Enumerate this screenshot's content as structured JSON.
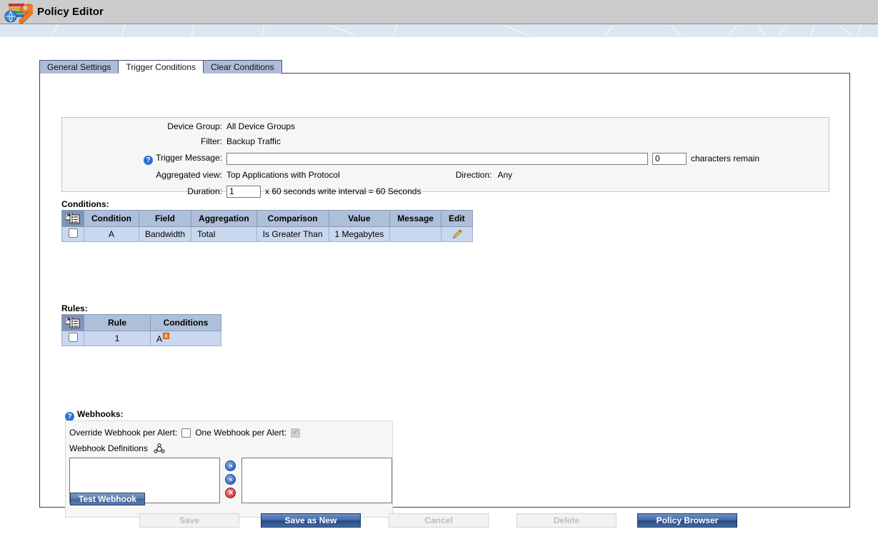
{
  "app": {
    "title": "Policy Editor",
    "logo_icon": "bar-chart-globe-wrench-icon"
  },
  "tabs": [
    {
      "label": "General Settings",
      "active": false
    },
    {
      "label": "Trigger Conditions",
      "active": true
    },
    {
      "label": "Clear Conditions",
      "active": false
    }
  ],
  "info": {
    "device_group_label": "Device Group:",
    "device_group_value": "All Device Groups",
    "filter_label": "Filter:",
    "filter_value": "Backup Traffic",
    "trigger_message_label": "Trigger Message:",
    "trigger_message_value": "",
    "trigger_message_help_icon": "help-icon",
    "chars_remain_value": "0",
    "chars_remain_label": "characters remain",
    "aggregated_view_label": "Aggregated view:",
    "aggregated_view_value": "Top Applications with Protocol",
    "direction_label": "Direction:",
    "direction_value": "Any",
    "duration_label": "Duration:",
    "duration_value": "1",
    "duration_note": "x 60 seconds write interval = 60 Seconds"
  },
  "conditions": {
    "section_label": "Conditions:",
    "select_icon": "select-list-icon",
    "columns": [
      "Condition",
      "Field",
      "Aggregation",
      "Comparison",
      "Value",
      "Message",
      "Edit"
    ],
    "rows": [
      {
        "checked": false,
        "condition": "A",
        "field": "Bandwidth",
        "aggregation": "Total",
        "comparison": "Is Greater Than",
        "value": "1 Megabytes",
        "message": "",
        "edit_icon": "pencil-icon"
      }
    ]
  },
  "rules": {
    "section_label": "Rules:",
    "select_icon": "select-list-icon",
    "columns": [
      "Rule",
      "Conditions"
    ],
    "rows": [
      {
        "checked": false,
        "rule": "1",
        "conditions": "A",
        "remove_badge": "x"
      }
    ]
  },
  "webhooks": {
    "section_label": "Webhooks:",
    "help_icon": "help-icon",
    "override_label": "Override Webhook per Alert:",
    "override_checked": false,
    "one_per_alert_label": "One Webhook per Alert:",
    "one_per_alert_checked": true,
    "one_per_alert_disabled": true,
    "definitions_label": "Webhook Definitions",
    "definitions_icon": "gear-cog-icon",
    "available_items": [],
    "selected_items": [],
    "move_right_icon": "double-chevron-right-icon",
    "move_left_icon": "double-chevron-left-icon",
    "delete_icon": "delete-x-icon",
    "test_button_label": "Test Webhook"
  },
  "footer": {
    "buttons": [
      {
        "label": "Save",
        "enabled": false
      },
      {
        "label": "Save as New",
        "enabled": true
      },
      {
        "label": "Cancel",
        "enabled": false
      },
      {
        "label": "Delete",
        "enabled": false
      },
      {
        "label": "Policy Browser",
        "enabled": true
      }
    ]
  },
  "colors": {
    "titlebar": "#cccccc",
    "band": "#dde7f3",
    "tab_inactive": "#afbcd7",
    "tab_active": "#ffffff",
    "table_header": "#aebfd9",
    "table_header_select": "#7f94bb",
    "table_row": "#c9d8ee",
    "primary_button": "#3f67a8",
    "panel_border": "#3a3f5c"
  }
}
